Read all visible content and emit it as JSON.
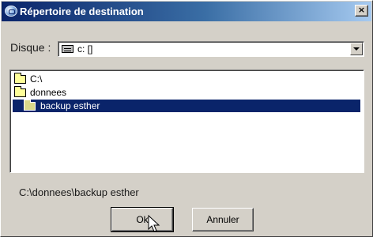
{
  "window": {
    "title": "Répertoire de destination",
    "close_label": "×"
  },
  "drive": {
    "label": "Disque :",
    "value": "c: []"
  },
  "folders": [
    {
      "name": "C:\\",
      "selected": false
    },
    {
      "name": "donnees",
      "selected": false
    },
    {
      "name": "backup esther",
      "selected": true
    }
  ],
  "current_path": "C:\\donnees\\backup esther",
  "buttons": {
    "ok_label": "Ok",
    "cancel_label": "Annuler"
  },
  "colors": {
    "title_start": "#0a246a",
    "title_end": "#a6caf0",
    "selection": "#0a246a",
    "face": "#d4d0c8"
  }
}
